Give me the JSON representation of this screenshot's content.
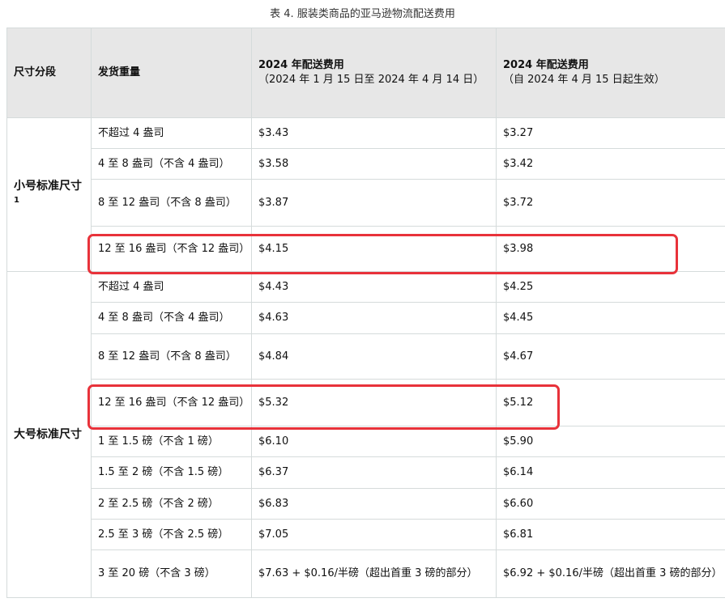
{
  "caption": "表 4. 服装类商品的亚马逊物流配送费用",
  "headers": {
    "size_tier": "尺寸分段",
    "weight": "发货重量",
    "fee_2024_old_title": "2024 年配送费用",
    "fee_2024_old_sub": "（2024 年 1 月 15 日至 2024 年 4 月 14 日）",
    "fee_2024_new_title": "2024 年配送费用",
    "fee_2024_new_sub": "（自 2024 年 4 月 15 日起生效）"
  },
  "small_standard": {
    "label": "小号标准尺寸",
    "footnote": "1",
    "rows": [
      {
        "weight": "不超过 4 盎司",
        "fee_old": "$3.43",
        "fee_new": "$3.27"
      },
      {
        "weight": "4 至 8 盎司（不含 4 盎司）",
        "fee_old": "$3.58",
        "fee_new": "$3.42"
      },
      {
        "weight": "8 至 12 盎司（不含 8 盎司）",
        "fee_old": "$3.87",
        "fee_new": "$3.72"
      },
      {
        "weight": "12 至 16 盎司（不含 12 盎司）",
        "fee_old": "$4.15",
        "fee_new": "$3.98"
      }
    ]
  },
  "large_standard": {
    "label": "大号标准尺寸",
    "rows": [
      {
        "weight": "不超过 4 盎司",
        "fee_old": "$4.43",
        "fee_new": "$4.25"
      },
      {
        "weight": "4 至 8 盎司（不含 4 盎司）",
        "fee_old": "$4.63",
        "fee_new": "$4.45"
      },
      {
        "weight": "8 至 12 盎司（不含 8 盎司）",
        "fee_old": "$4.84",
        "fee_new": "$4.67"
      },
      {
        "weight": "12 至 16 盎司（不含 12 盎司）",
        "fee_old": "$5.32",
        "fee_new": "$5.12"
      },
      {
        "weight": "1 至 1.5 磅（不含 1 磅）",
        "fee_old": "$6.10",
        "fee_new": "$5.90"
      },
      {
        "weight": "1.5 至 2 磅（不含 1.5 磅）",
        "fee_old": "$6.37",
        "fee_new": "$6.14"
      },
      {
        "weight": "2 至 2.5 磅（不含 2 磅）",
        "fee_old": "$6.83",
        "fee_new": "$6.60"
      },
      {
        "weight": "2.5 至 3 磅（不含 2.5 磅）",
        "fee_old": "$7.05",
        "fee_new": "$6.81"
      },
      {
        "weight": "3 至 20 磅（不含 3 磅）",
        "fee_old": "$7.63 + $0.16/半磅（超出首重 3 磅的部分）",
        "fee_new": "$6.92 + $0.16/半磅（超出首重 3 磅的部分）"
      }
    ]
  },
  "highlight_color": "#e8323a"
}
